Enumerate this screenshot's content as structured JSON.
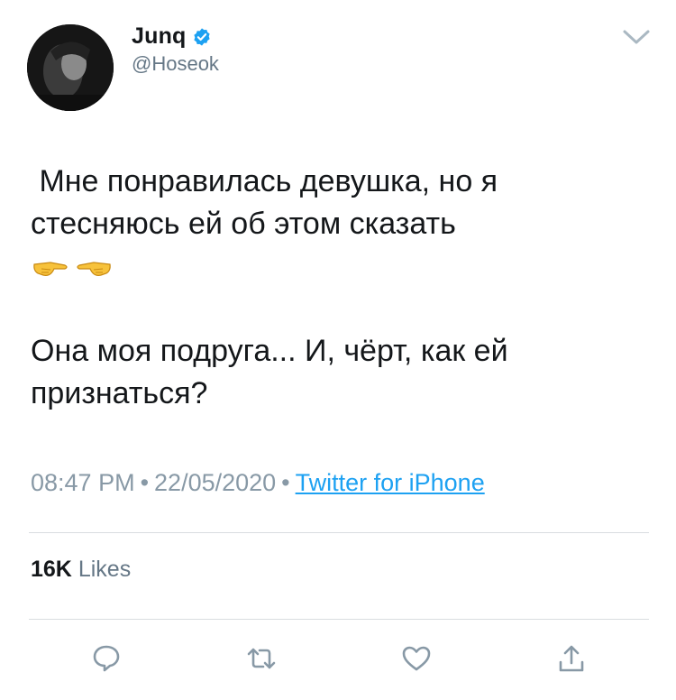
{
  "user": {
    "display_name": "Junq",
    "handle": "@Hoseok",
    "verified": true,
    "avatar_icon": "profile-photo"
  },
  "tweet": {
    "paragraph1": " Мне понравилась девушка, но я стесняюсь ей об этом сказать",
    "emojis": [
      "backhand-index-pointing-right",
      "backhand-index-pointing-left"
    ],
    "paragraph2": "Она моя подруга... И, чёрт, как ей признаться?"
  },
  "meta": {
    "time": "08:47 PM",
    "separator": "•",
    "date": "22/05/2020",
    "source": "Twitter for iPhone"
  },
  "stats": {
    "likes_count": "16K",
    "likes_label": "Likes"
  },
  "actions": {
    "icons": [
      "reply-icon",
      "retweet-icon",
      "like-icon",
      "share-icon"
    ]
  },
  "colors": {
    "link": "#1da1f2",
    "verified": "#1da1f2",
    "secondary_text": "#8899a6",
    "primary_text": "#14171a"
  }
}
